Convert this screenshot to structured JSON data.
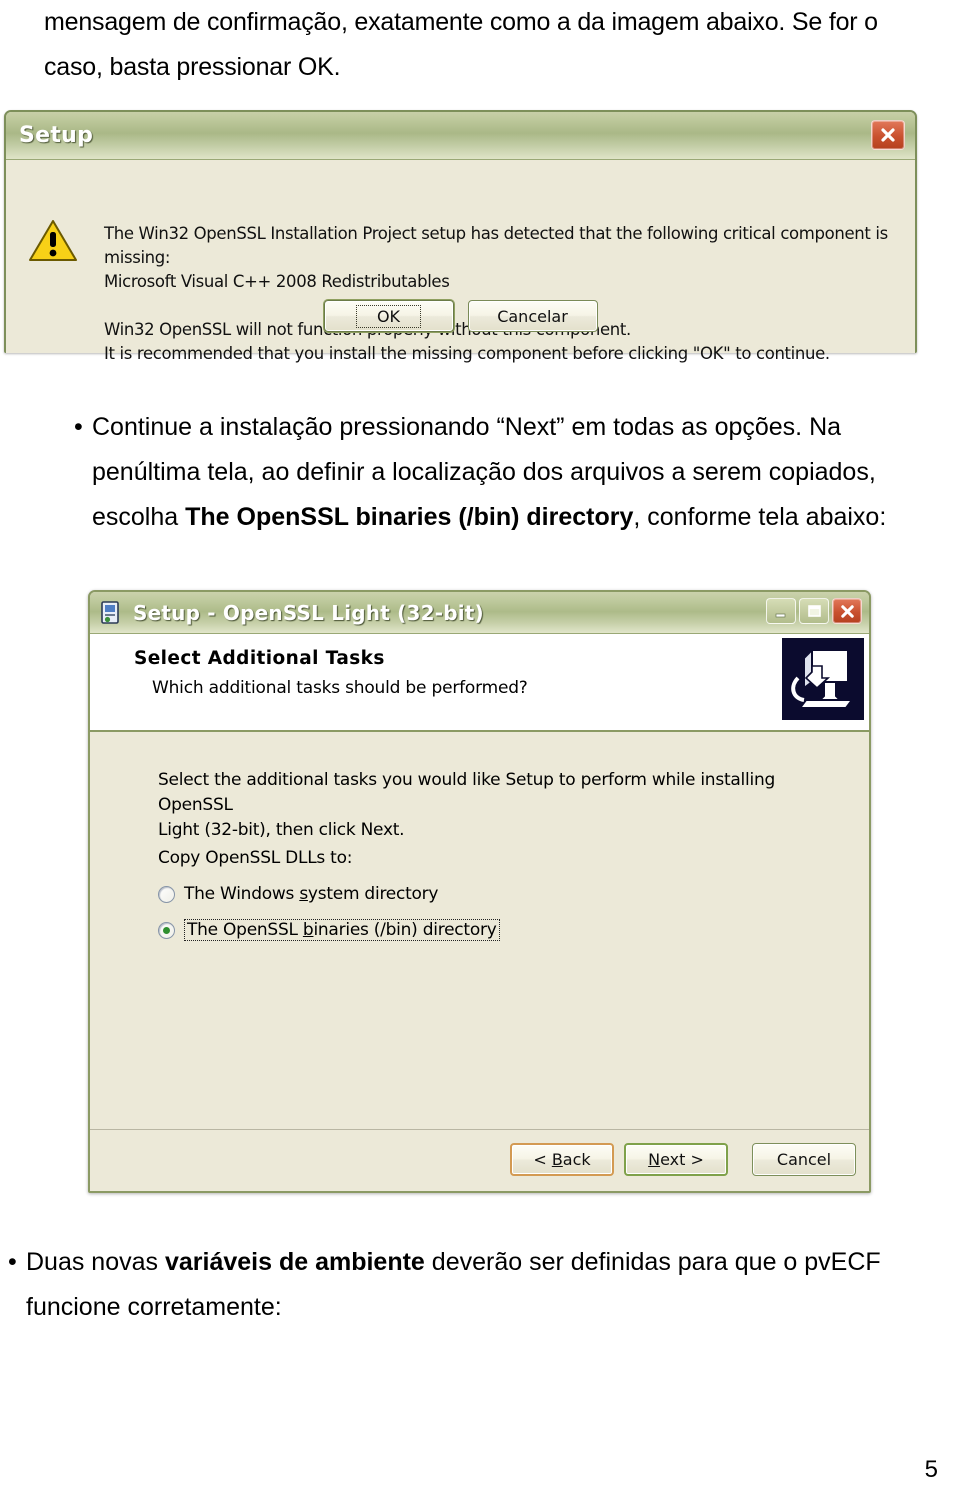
{
  "document": {
    "top_paragraph": {
      "line1": "mensagem de confirmação, exatamente como a da imagem abaixo. Se for o",
      "line2": "caso, basta pressionar OK."
    },
    "middle_bullet": {
      "bullet": "•",
      "line1": "Continue a instalação pressionando “Next” em todas as opções. Na",
      "line2": "penúltima tela, ao definir a localização dos arquivos a serem copiados,",
      "line3_prefix": "escolha ",
      "line3_bold": "The OpenSSL binaries (/bin) directory",
      "line3_suffix": ", conforme tela abaixo:"
    },
    "bottom_bullet": {
      "bullet": "•",
      "line1_prefix": "Duas novas ",
      "line1_bold": "variáveis de ambiente",
      "line1_suffix": " deverão ser definidas para que o pvECF",
      "line2": "funcione corretamente:"
    },
    "page_number": "5"
  },
  "dialog_warning": {
    "title": "Setup",
    "close_icon": "close-icon",
    "warning_icon": "warning-triangle-icon",
    "message_line1": "The Win32 OpenSSL Installation Project setup has detected that the following critical component is missing:",
    "message_line2": "Microsoft Visual C++ 2008 Redistributables",
    "message_line3": "Win32 OpenSSL will not function properly without this component.",
    "message_line4": "It is recommended that you install the missing component before clicking \"OK\" to continue.",
    "ok_label": "OK",
    "cancel_label": "Cancelar"
  },
  "dialog_setup": {
    "title": "Setup - OpenSSL Light (32-bit)",
    "app_icon": "installer-icon",
    "minimize_label": "_",
    "maximize_label": "□",
    "close_label": "✕",
    "header_title": "Select Additional Tasks",
    "header_subtitle": "Which additional tasks should be performed?",
    "header_icon": "computer-download-icon",
    "body_line1": "Select the additional tasks you would like Setup to perform while installing OpenSSL",
    "body_line2": "Light (32-bit), then click Next.",
    "copy_label": "Copy OpenSSL DLLs to:",
    "options": [
      {
        "label_pre": "The Windows ",
        "label_underline": "s",
        "label_post": "ystem directory",
        "selected": false
      },
      {
        "label_pre": "The OpenSSL ",
        "label_underline": "b",
        "label_post": "inaries (/bin) director",
        "label_post2": "y",
        "selected": true
      }
    ],
    "back_pre": "< ",
    "back_underline": "B",
    "back_post": "ack",
    "next_underline": "N",
    "next_post": "ext >",
    "cancel_label": "Cancel"
  },
  "colors": {
    "dialog_face": "#ece9d8",
    "title_green": "#adbb89",
    "border_green": "#8b9a64",
    "close_red": "#c9512f",
    "radio_green": "#2f8f2f",
    "back_orange": "#d39a52",
    "next_green": "#7fa14a",
    "icon_navy": "#0b0b2e"
  }
}
